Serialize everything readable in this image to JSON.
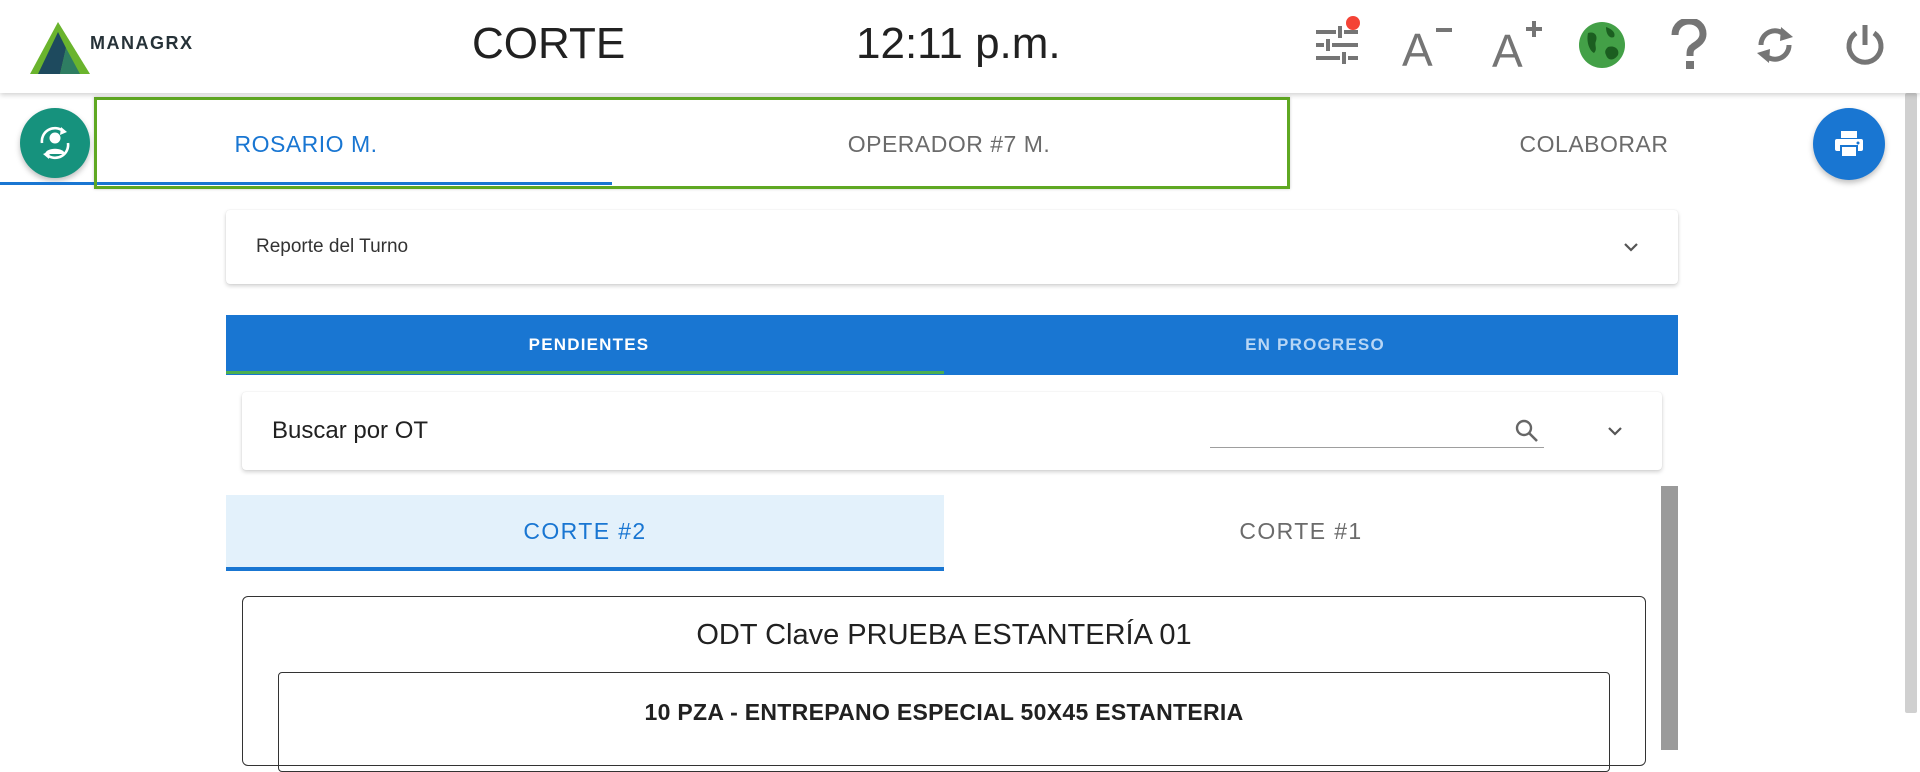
{
  "header": {
    "logo_text": "MANAGRX",
    "screen_title": "CORTE",
    "clock": "12:11 p.m.",
    "icons": [
      "filters-icon",
      "font-decrease-icon",
      "font-increase-icon",
      "globe-icon",
      "help-icon",
      "refresh-icon",
      "power-icon"
    ]
  },
  "operator_tabs": [
    {
      "label": "ROSARIO M.",
      "active": true
    },
    {
      "label": "OPERADOR #7 M.",
      "active": false
    },
    {
      "label": "COLABORAR",
      "active": false
    }
  ],
  "report_panel": {
    "label": "Reporte del Turno"
  },
  "status_tabs": [
    {
      "label": "PENDIENTES",
      "active": true
    },
    {
      "label": "EN PROGRESO",
      "active": false
    }
  ],
  "search": {
    "title": "Buscar por OT",
    "value": "",
    "placeholder": ""
  },
  "corte_tabs": [
    {
      "label": "CORTE #2",
      "active": true
    },
    {
      "label": "CORTE #1",
      "active": false
    }
  ],
  "odt": {
    "title": "ODT Clave PRUEBA ESTANTERÍA 01",
    "items": [
      {
        "label": "10 PZA - ENTREPANO ESPECIAL 50X45 ESTANTERIA"
      }
    ]
  },
  "colors": {
    "primary": "#1976d2",
    "teal": "#16927d",
    "highlight_border": "#5fa822",
    "globe": "#43a047",
    "badge": "#f44336"
  }
}
